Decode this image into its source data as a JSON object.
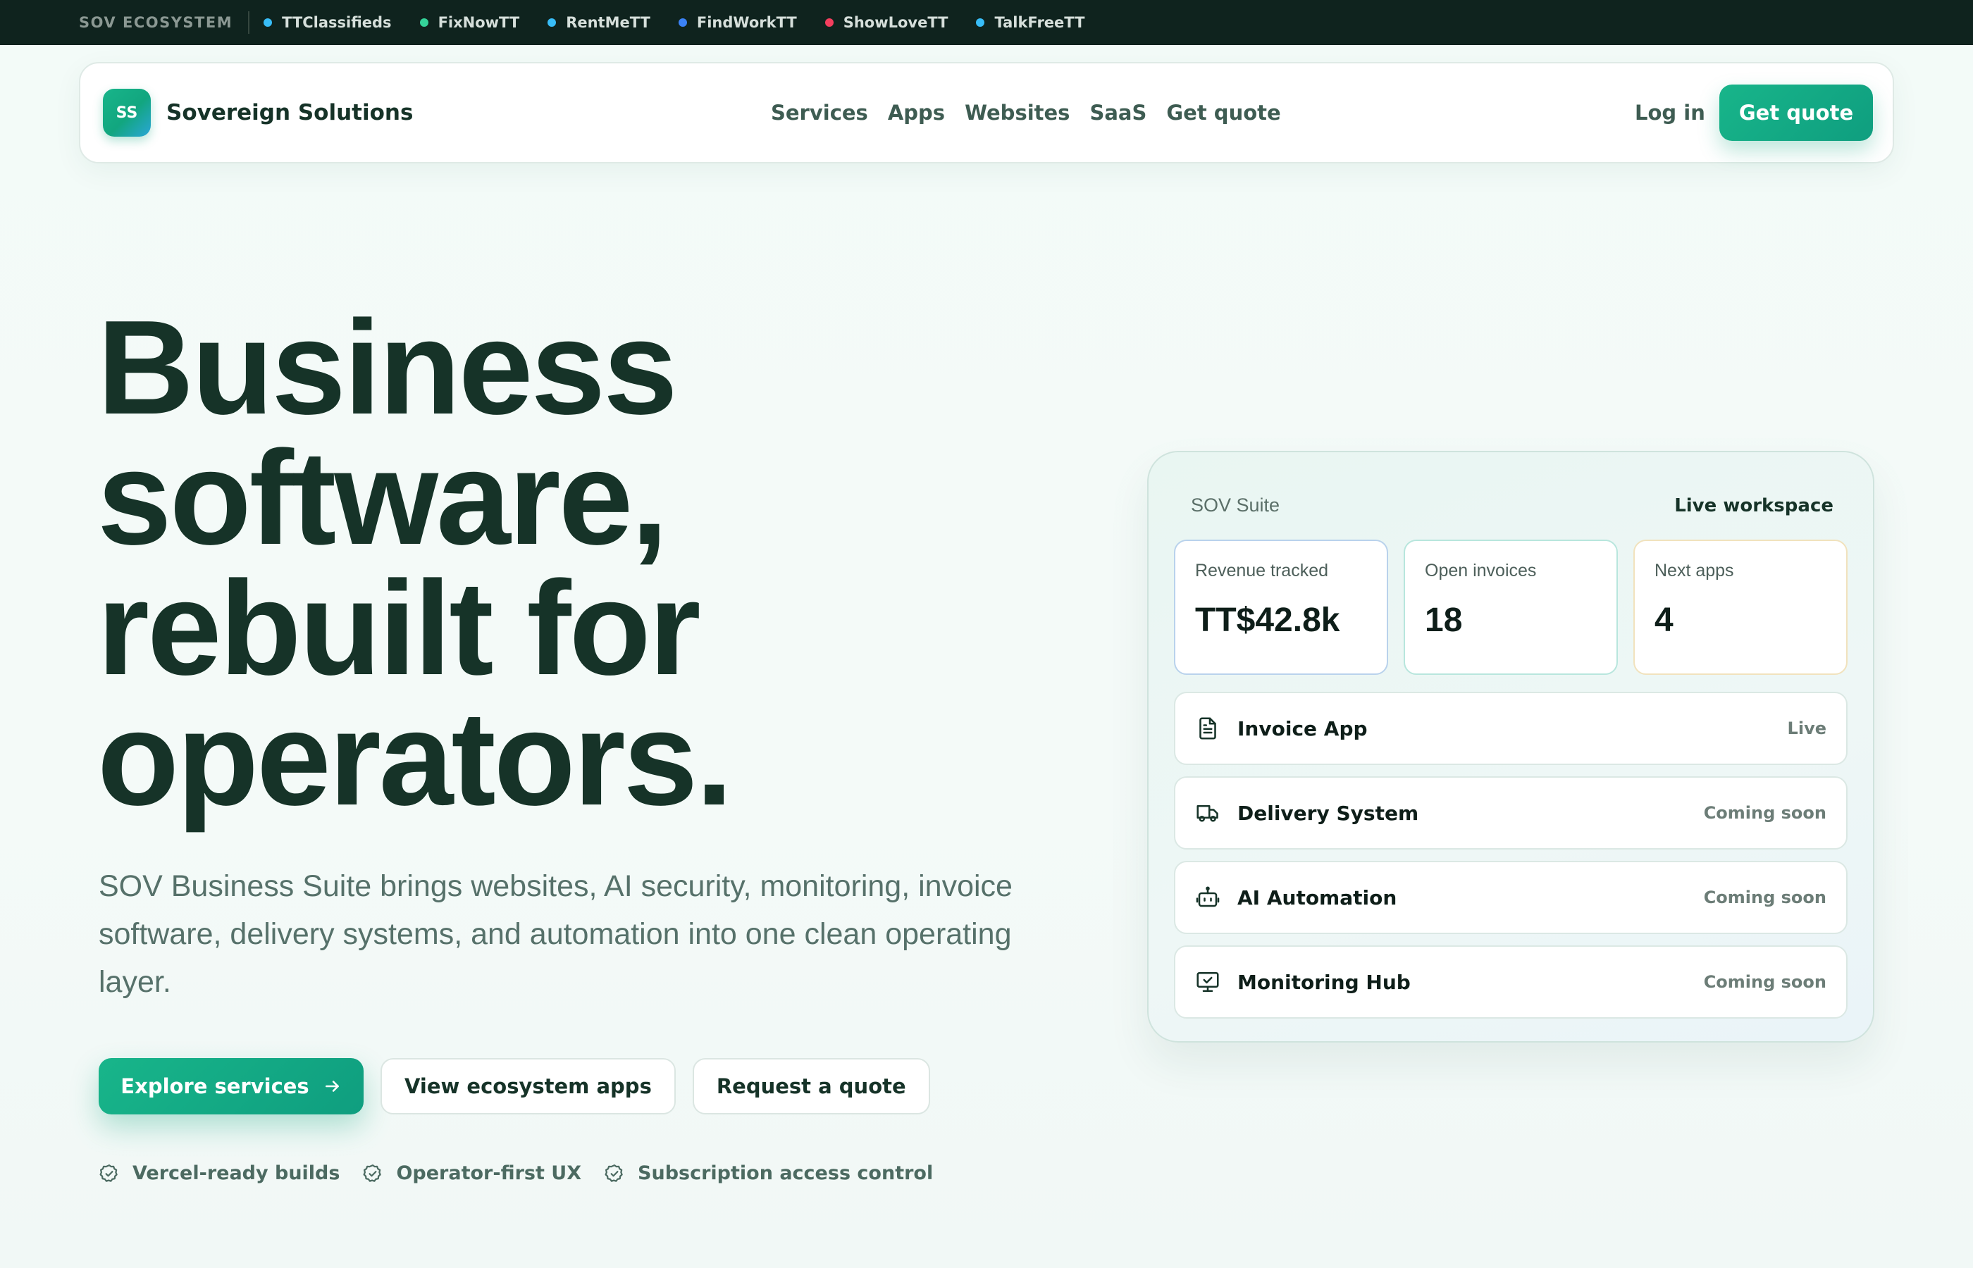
{
  "ecosystem": {
    "label": "SOV ECOSYSTEM",
    "links": [
      {
        "label": "TTClassifieds",
        "dot_color": "#38bdf8"
      },
      {
        "label": "FixNowTT",
        "dot_color": "#34d399"
      },
      {
        "label": "RentMeTT",
        "dot_color": "#38bdf8"
      },
      {
        "label": "FindWorkTT",
        "dot_color": "#3b82f6"
      },
      {
        "label": "ShowLoveTT",
        "dot_color": "#f43f5e"
      },
      {
        "label": "TalkFreeTT",
        "dot_color": "#38bdf8"
      }
    ]
  },
  "nav": {
    "logo_text": "SS",
    "brand_name": "Sovereign Solutions",
    "links": [
      "Services",
      "Apps",
      "Websites",
      "SaaS",
      "Get quote"
    ],
    "login": "Log in",
    "cta": "Get quote"
  },
  "hero": {
    "title_lines": [
      "Business",
      "software,",
      "rebuilt for",
      "operators."
    ],
    "subtitle": "SOV Business Suite brings websites, AI security, monitoring, invoice software, delivery systems, and automation into one clean operating layer.",
    "buttons": {
      "primary": "Explore services",
      "ecosystem": "View ecosystem apps",
      "quote": "Request a quote"
    },
    "features": [
      "Vercel-ready builds",
      "Operator-first UX",
      "Subscription access control"
    ]
  },
  "suite": {
    "name": "SOV Suite",
    "status": "Live workspace",
    "stats": [
      {
        "label": "Revenue tracked",
        "value": "TT$42.8k"
      },
      {
        "label": "Open invoices",
        "value": "18"
      },
      {
        "label": "Next apps",
        "value": "4"
      }
    ],
    "apps": [
      {
        "name": "Invoice App",
        "status": "Live",
        "icon": "document-icon"
      },
      {
        "name": "Delivery System",
        "status": "Coming soon",
        "icon": "truck-icon"
      },
      {
        "name": "AI Automation",
        "status": "Coming soon",
        "icon": "robot-icon"
      },
      {
        "name": "Monitoring Hub",
        "status": "Coming soon",
        "icon": "monitor-icon"
      }
    ]
  },
  "colors": {
    "accent": "#12a67f",
    "dark": "#163328",
    "ecosystem_bar": "#0f231e"
  }
}
